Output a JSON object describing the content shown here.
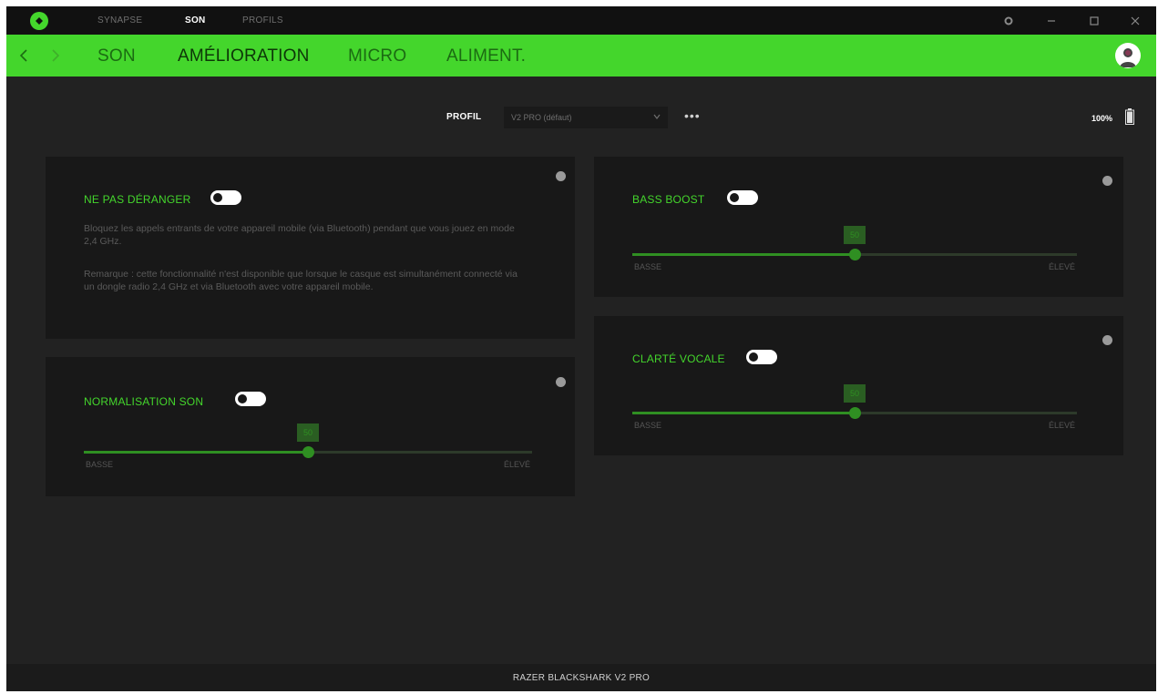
{
  "titlebar": {
    "tabs": [
      {
        "label": "SYNAPSE",
        "active": false
      },
      {
        "label": "SON",
        "active": true
      },
      {
        "label": "PROFILS",
        "active": false
      }
    ]
  },
  "navbar": {
    "tabs": [
      {
        "label": "SON",
        "active": false
      },
      {
        "label": "AMÉLIORATION",
        "active": true
      },
      {
        "label": "MICRO",
        "active": false
      },
      {
        "label": "ALIMENT.",
        "active": false
      }
    ]
  },
  "profile": {
    "label": "PROFIL",
    "selected": "V2 PRO (défaut)",
    "more": "•••"
  },
  "battery": {
    "percent_label": "100%"
  },
  "panels": {
    "dnd": {
      "title": "NE PAS DÉRANGER",
      "enabled": false,
      "desc1": "Bloquez les appels entrants de votre appareil mobile (via Bluetooth) pendant que vous jouez en mode 2,4 GHz.",
      "desc2": "Remarque : cette fonctionnalité n'est disponible que lorsque le casque est simultanément connecté via un dongle radio 2,4 GHz et via Bluetooth avec votre appareil mobile."
    },
    "normalisation": {
      "title": "NORMALISATION SON",
      "enabled": false,
      "slider": {
        "value": 50,
        "low": "BASSE",
        "high": "ÉLEVÉ"
      }
    },
    "bass": {
      "title": "BASS BOOST",
      "enabled": false,
      "slider": {
        "value": 50,
        "low": "BASSE",
        "high": "ÉLEVÉ"
      }
    },
    "voice": {
      "title": "CLARTÉ VOCALE",
      "enabled": false,
      "slider": {
        "value": 50,
        "low": "BASSE",
        "high": "ÉLEVÉ"
      }
    }
  },
  "footer": {
    "device": "RAZER BLACKSHARK V2 PRO"
  },
  "colors": {
    "accent": "#44d62c",
    "background": "#222222",
    "panel": "#181818"
  }
}
